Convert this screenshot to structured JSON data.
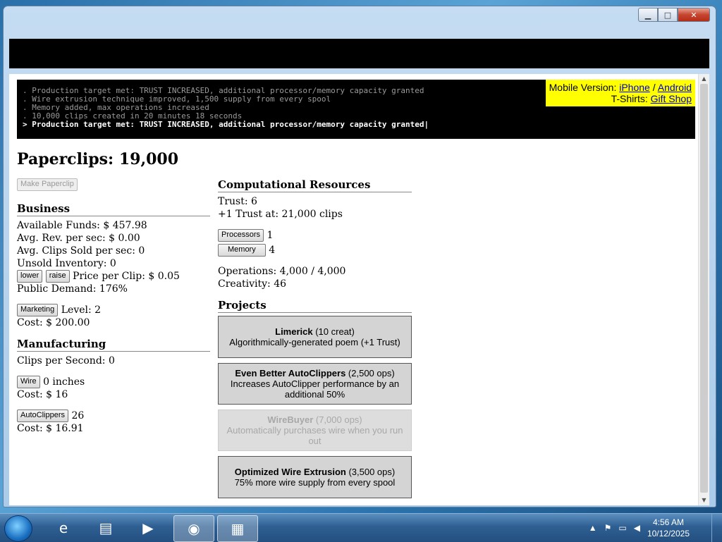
{
  "console": {
    "lines": [
      ". Production target met: TRUST INCREASED, additional processor/memory capacity granted",
      ". Wire extrusion technique improved, 1,500 supply from every spool",
      ". Memory added, max operations increased",
      ". 10,000 clips created in 20 minutes 18 seconds"
    ],
    "current": "> Production target met: TRUST INCREASED, additional processor/memory capacity granted|"
  },
  "promo": {
    "mobile_label": "Mobile Version:",
    "iphone": "iPhone",
    "sep": "/",
    "android": "Android",
    "tshirts_label": "T-Shirts:",
    "gift_shop": "Gift Shop"
  },
  "title": "Paperclips: 19,000",
  "make_button": "Make Paperclip",
  "business": {
    "header": "Business",
    "funds": "Available Funds: $ 457.98",
    "rev": "Avg. Rev. per sec: $ 0.00",
    "sold": "Avg. Clips Sold per sec: 0",
    "inventory": "Unsold Inventory: 0",
    "lower": "lower",
    "raise": "raise",
    "price": "Price per Clip: $ 0.05",
    "demand": "Public Demand: 176%",
    "marketing_btn": "Marketing",
    "level": "Level: 2",
    "cost": "Cost: $ 200.00"
  },
  "manufacturing": {
    "header": "Manufacturing",
    "cps": "Clips per Second: 0",
    "wire_btn": "Wire",
    "wire_value": "0 inches",
    "wire_cost": "Cost: $ 16",
    "auto_btn": "AutoClippers",
    "auto_count": "26",
    "auto_cost": "Cost: $ 16.91"
  },
  "computational": {
    "header": "Computational Resources",
    "trust": "Trust: 6",
    "next_trust": "+1 Trust at: 21,000 clips",
    "processors_btn": "Processors",
    "processors": "1",
    "memory_btn": "Memory",
    "memory": "4",
    "operations": "Operations: 4,000 / 4,000",
    "creativity": "Creativity: 46"
  },
  "projects": {
    "header": "Projects",
    "items": [
      {
        "name": "Limerick",
        "cost": " (10 creat)",
        "desc": "Algorithmically-generated poem (+1 Trust)"
      },
      {
        "name": "Even Better AutoClippers",
        "cost": " (2,500 ops)",
        "desc": "Increases AutoClipper performance by an additional 50%"
      },
      {
        "name": "WireBuyer",
        "cost": " (7,000 ops)",
        "desc": "Automatically purchases wire when you run out"
      },
      {
        "name": "Optimized Wire Extrusion",
        "cost": " (3,500 ops)",
        "desc": "75% more wire supply from every spool"
      }
    ]
  },
  "taskbar": {
    "time": "4:56 AM",
    "date": "10/12/2025"
  }
}
